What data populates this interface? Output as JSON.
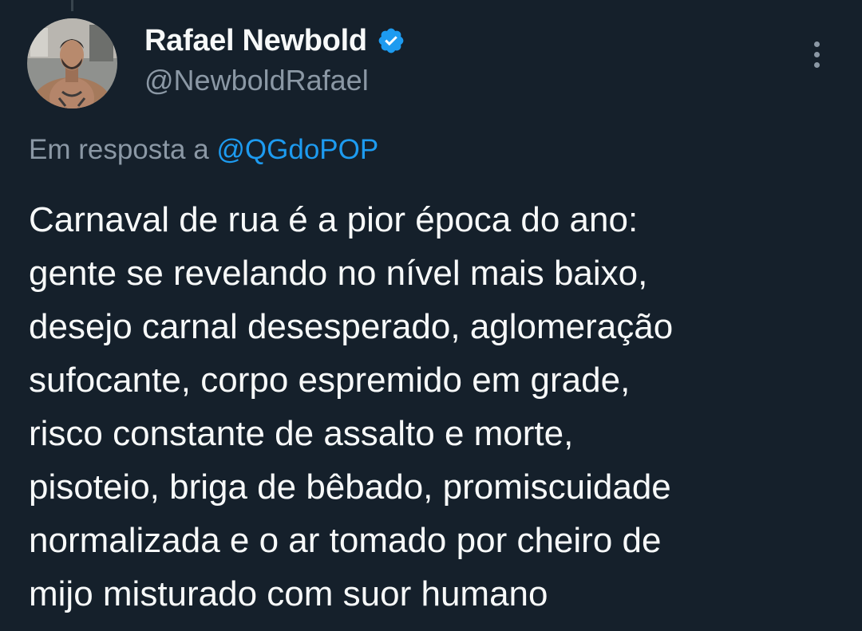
{
  "author": {
    "display_name": "Rafael Newbold",
    "handle": "@NewboldRafael",
    "verified": true,
    "avatar_icon": "profile-photo"
  },
  "reply_context": {
    "prefix": "Em resposta a",
    "mention": "@QGdoPOP"
  },
  "tweet": {
    "lines": [
      "Carnaval de rua é a pior época do ano:",
      "gente se revelando no nível mais baixo,",
      "desejo carnal desesperado, aglomeração",
      "sufocante, corpo espremido em grade,",
      "risco constante de assalto e morte,",
      "pisoteio, briga de bêbado, promiscuidade",
      "normalizada e o ar tomado por cheiro de",
      "mijo misturado com suor humano"
    ]
  },
  "colors": {
    "background": "#15202b",
    "text": "#f7f9f9",
    "secondary_text": "#8b98a5",
    "accent": "#1d9bf0"
  },
  "icons": {
    "verified": "verified-badge-icon",
    "more": "more-options-icon"
  }
}
